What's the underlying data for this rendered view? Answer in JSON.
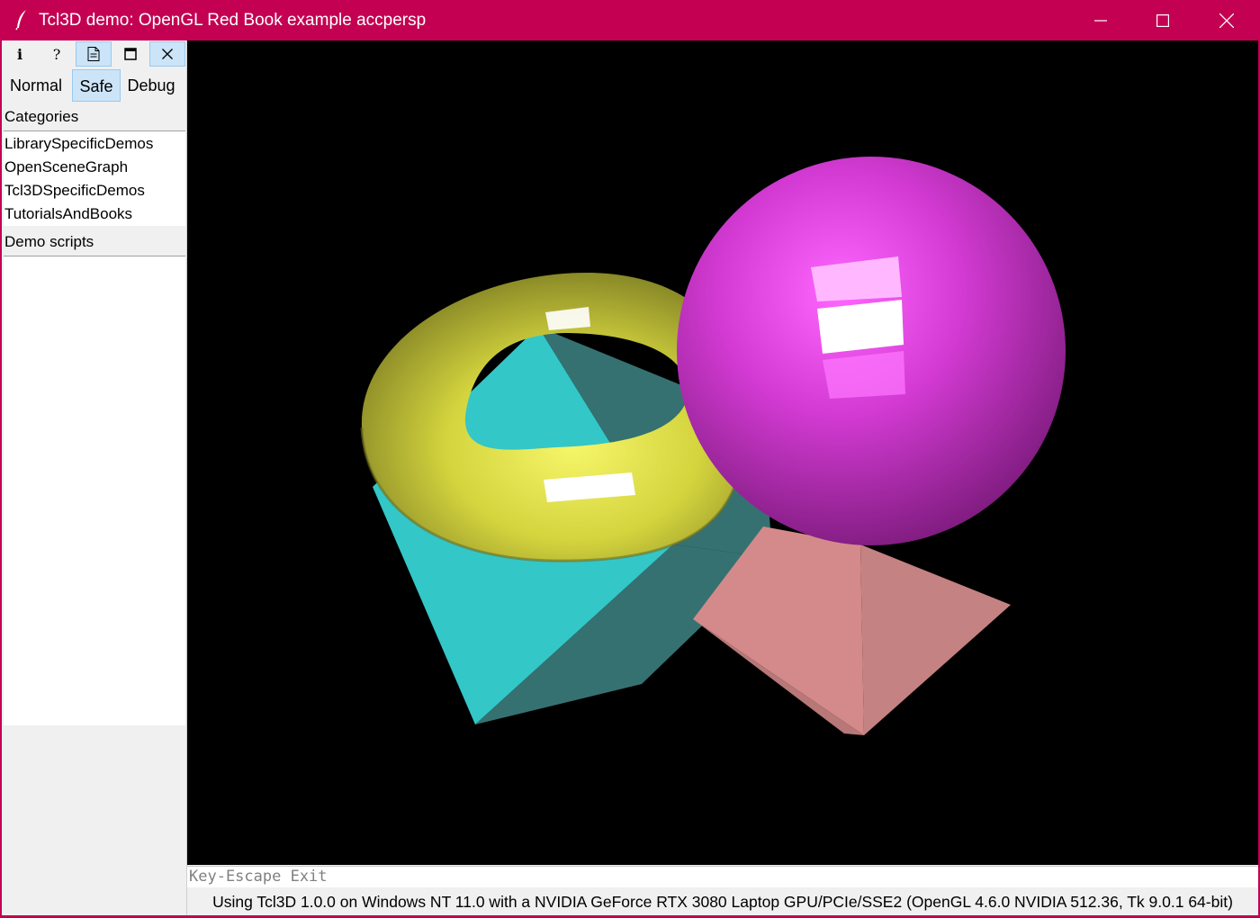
{
  "window": {
    "title": "Tcl3D demo: OpenGL Red Book example accpersp",
    "app_icon": "feather-icon",
    "controls": [
      "minimize-icon",
      "maximize-icon",
      "close-icon"
    ]
  },
  "toolbar": {
    "buttons": [
      {
        "icon": "info-icon",
        "glyph": "i",
        "active": false
      },
      {
        "icon": "help-icon",
        "glyph": "?",
        "active": false
      },
      {
        "icon": "document-icon",
        "glyph": "",
        "active": true
      },
      {
        "icon": "fullscreen-icon",
        "glyph": "",
        "active": false
      },
      {
        "icon": "close-icon",
        "glyph": "",
        "active": true
      }
    ]
  },
  "modes": {
    "normal": "Normal",
    "safe": "Safe",
    "debug": "Debug",
    "selected": "Safe"
  },
  "categories": {
    "label": "Categories",
    "items": [
      "LibrarySpecificDemos",
      "OpenSceneGraph",
      "Tcl3DSpecificDemos",
      "TutorialsAndBooks"
    ]
  },
  "demo_scripts": {
    "label": "Demo scripts",
    "items": []
  },
  "scene": {
    "background": "#000000",
    "torus_color": "#e0e040",
    "sphere_color": "#e040e0",
    "octahedron_color": "#33c7c7",
    "pyramid_color": "#d48a8a"
  },
  "info_line": "Key-Escape Exit",
  "status_line": "Using Tcl3D 1.0.0 on Windows NT 11.0 with a NVIDIA GeForce RTX 3080 Laptop GPU/PCIe/SSE2 (OpenGL 4.6.0 NVIDIA 512.36, Tk 9.0.1 64-bit)"
}
